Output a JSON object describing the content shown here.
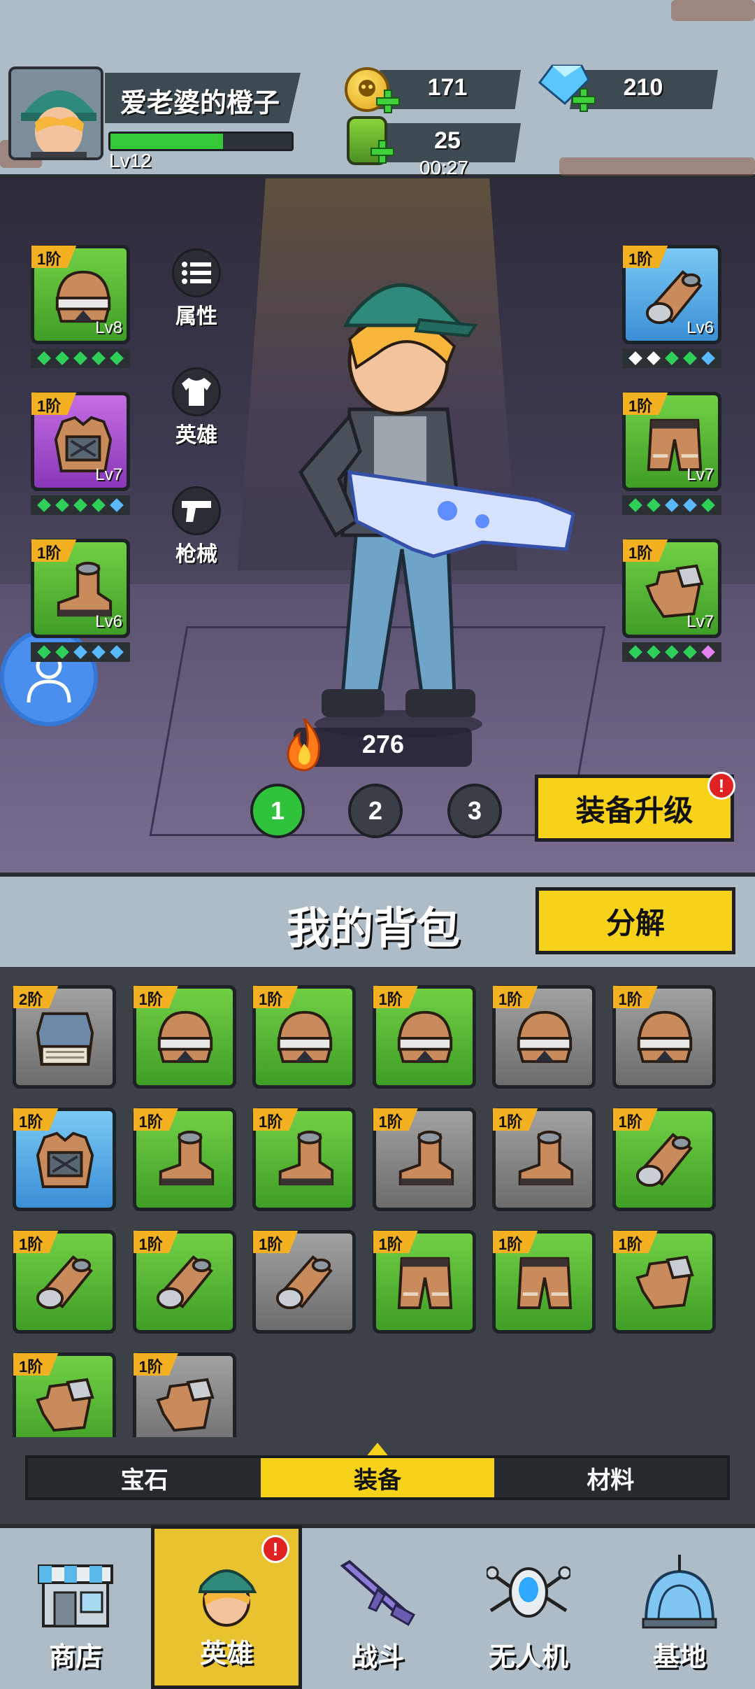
{
  "player": {
    "name": "爱老婆的橙子",
    "level": "Lv12",
    "exp_progress": 0.62
  },
  "resources": {
    "coins": "171",
    "gems": "210",
    "energy": "25",
    "energy_timer": "00:27"
  },
  "hero_panel": {
    "side_buttons": [
      "属性",
      "英雄",
      "枪械"
    ],
    "combat_power": "276",
    "loadouts": [
      "1",
      "2",
      "3"
    ],
    "active_loadout": "1",
    "upgrade_label": "装备升级",
    "upgrade_alert": "!",
    "equipped_left": [
      {
        "tier": "1阶",
        "level": "Lv8",
        "item": "helmet",
        "rarity": "green",
        "gems": [
          "#2fd05a",
          "#2fd05a",
          "#2fd05a",
          "#2fd05a",
          "#2fd05a"
        ]
      },
      {
        "tier": "1阶",
        "level": "Lv7",
        "item": "vest",
        "rarity": "purple",
        "gems": [
          "#2fd05a",
          "#2fd05a",
          "#2fd05a",
          "#2fd05a",
          "#5ab8ff"
        ]
      },
      {
        "tier": "1阶",
        "level": "Lv6",
        "item": "boots",
        "rarity": "green",
        "gems": [
          "#2fd05a",
          "#2fd05a",
          "#5ab8ff",
          "#5ab8ff",
          "#5ab8ff"
        ]
      }
    ],
    "equipped_right": [
      {
        "tier": "1阶",
        "level": "Lv6",
        "item": "gauntlet",
        "rarity": "blue",
        "gems": [
          "#ffffff",
          "#ffffff",
          "#2fd05a",
          "#2fd05a",
          "#5ab8ff"
        ]
      },
      {
        "tier": "1阶",
        "level": "Lv7",
        "item": "shorts",
        "rarity": "green",
        "gems": [
          "#2fd05a",
          "#2fd05a",
          "#5ab8ff",
          "#5ab8ff",
          "#2fd05a"
        ]
      },
      {
        "tier": "1阶",
        "level": "Lv7",
        "item": "gloves",
        "rarity": "green",
        "gems": [
          "#2fd05a",
          "#2fd05a",
          "#2fd05a",
          "#2fd05a",
          "#e383f0"
        ]
      }
    ]
  },
  "bag": {
    "title": "我的背包",
    "decompose_label": "分解",
    "items": [
      {
        "tier": "2阶",
        "item": "armor",
        "rarity": "gray"
      },
      {
        "tier": "1阶",
        "item": "helmet",
        "rarity": "green"
      },
      {
        "tier": "1阶",
        "item": "helmet",
        "rarity": "green"
      },
      {
        "tier": "1阶",
        "item": "helmet",
        "rarity": "green"
      },
      {
        "tier": "1阶",
        "item": "helmet",
        "rarity": "gray"
      },
      {
        "tier": "1阶",
        "item": "helmet",
        "rarity": "gray"
      },
      {
        "tier": "1阶",
        "item": "vest",
        "rarity": "blue"
      },
      {
        "tier": "1阶",
        "item": "boots",
        "rarity": "green"
      },
      {
        "tier": "1阶",
        "item": "boots",
        "rarity": "green"
      },
      {
        "tier": "1阶",
        "item": "boots",
        "rarity": "gray"
      },
      {
        "tier": "1阶",
        "item": "boots",
        "rarity": "gray"
      },
      {
        "tier": "1阶",
        "item": "gauntlet",
        "rarity": "green"
      },
      {
        "tier": "1阶",
        "item": "gauntlet",
        "rarity": "green"
      },
      {
        "tier": "1阶",
        "item": "gauntlet",
        "rarity": "green"
      },
      {
        "tier": "1阶",
        "item": "gauntlet",
        "rarity": "gray"
      },
      {
        "tier": "1阶",
        "item": "shorts",
        "rarity": "green"
      },
      {
        "tier": "1阶",
        "item": "shorts",
        "rarity": "green"
      },
      {
        "tier": "1阶",
        "item": "gloves",
        "rarity": "green"
      },
      {
        "tier": "1阶",
        "item": "gloves",
        "rarity": "green"
      },
      {
        "tier": "1阶",
        "item": "gloves",
        "rarity": "gray"
      }
    ],
    "tabs": [
      "宝石",
      "装备",
      "材料"
    ],
    "active_tab": "装备"
  },
  "nav": {
    "items": [
      {
        "label": "商店",
        "icon": "shop-icon"
      },
      {
        "label": "英雄",
        "icon": "hero-icon"
      },
      {
        "label": "战斗",
        "icon": "rifle-icon"
      },
      {
        "label": "无人机",
        "icon": "drone-icon"
      },
      {
        "label": "基地",
        "icon": "base-dome-icon"
      }
    ],
    "active": "英雄",
    "hero_alert": "!"
  }
}
